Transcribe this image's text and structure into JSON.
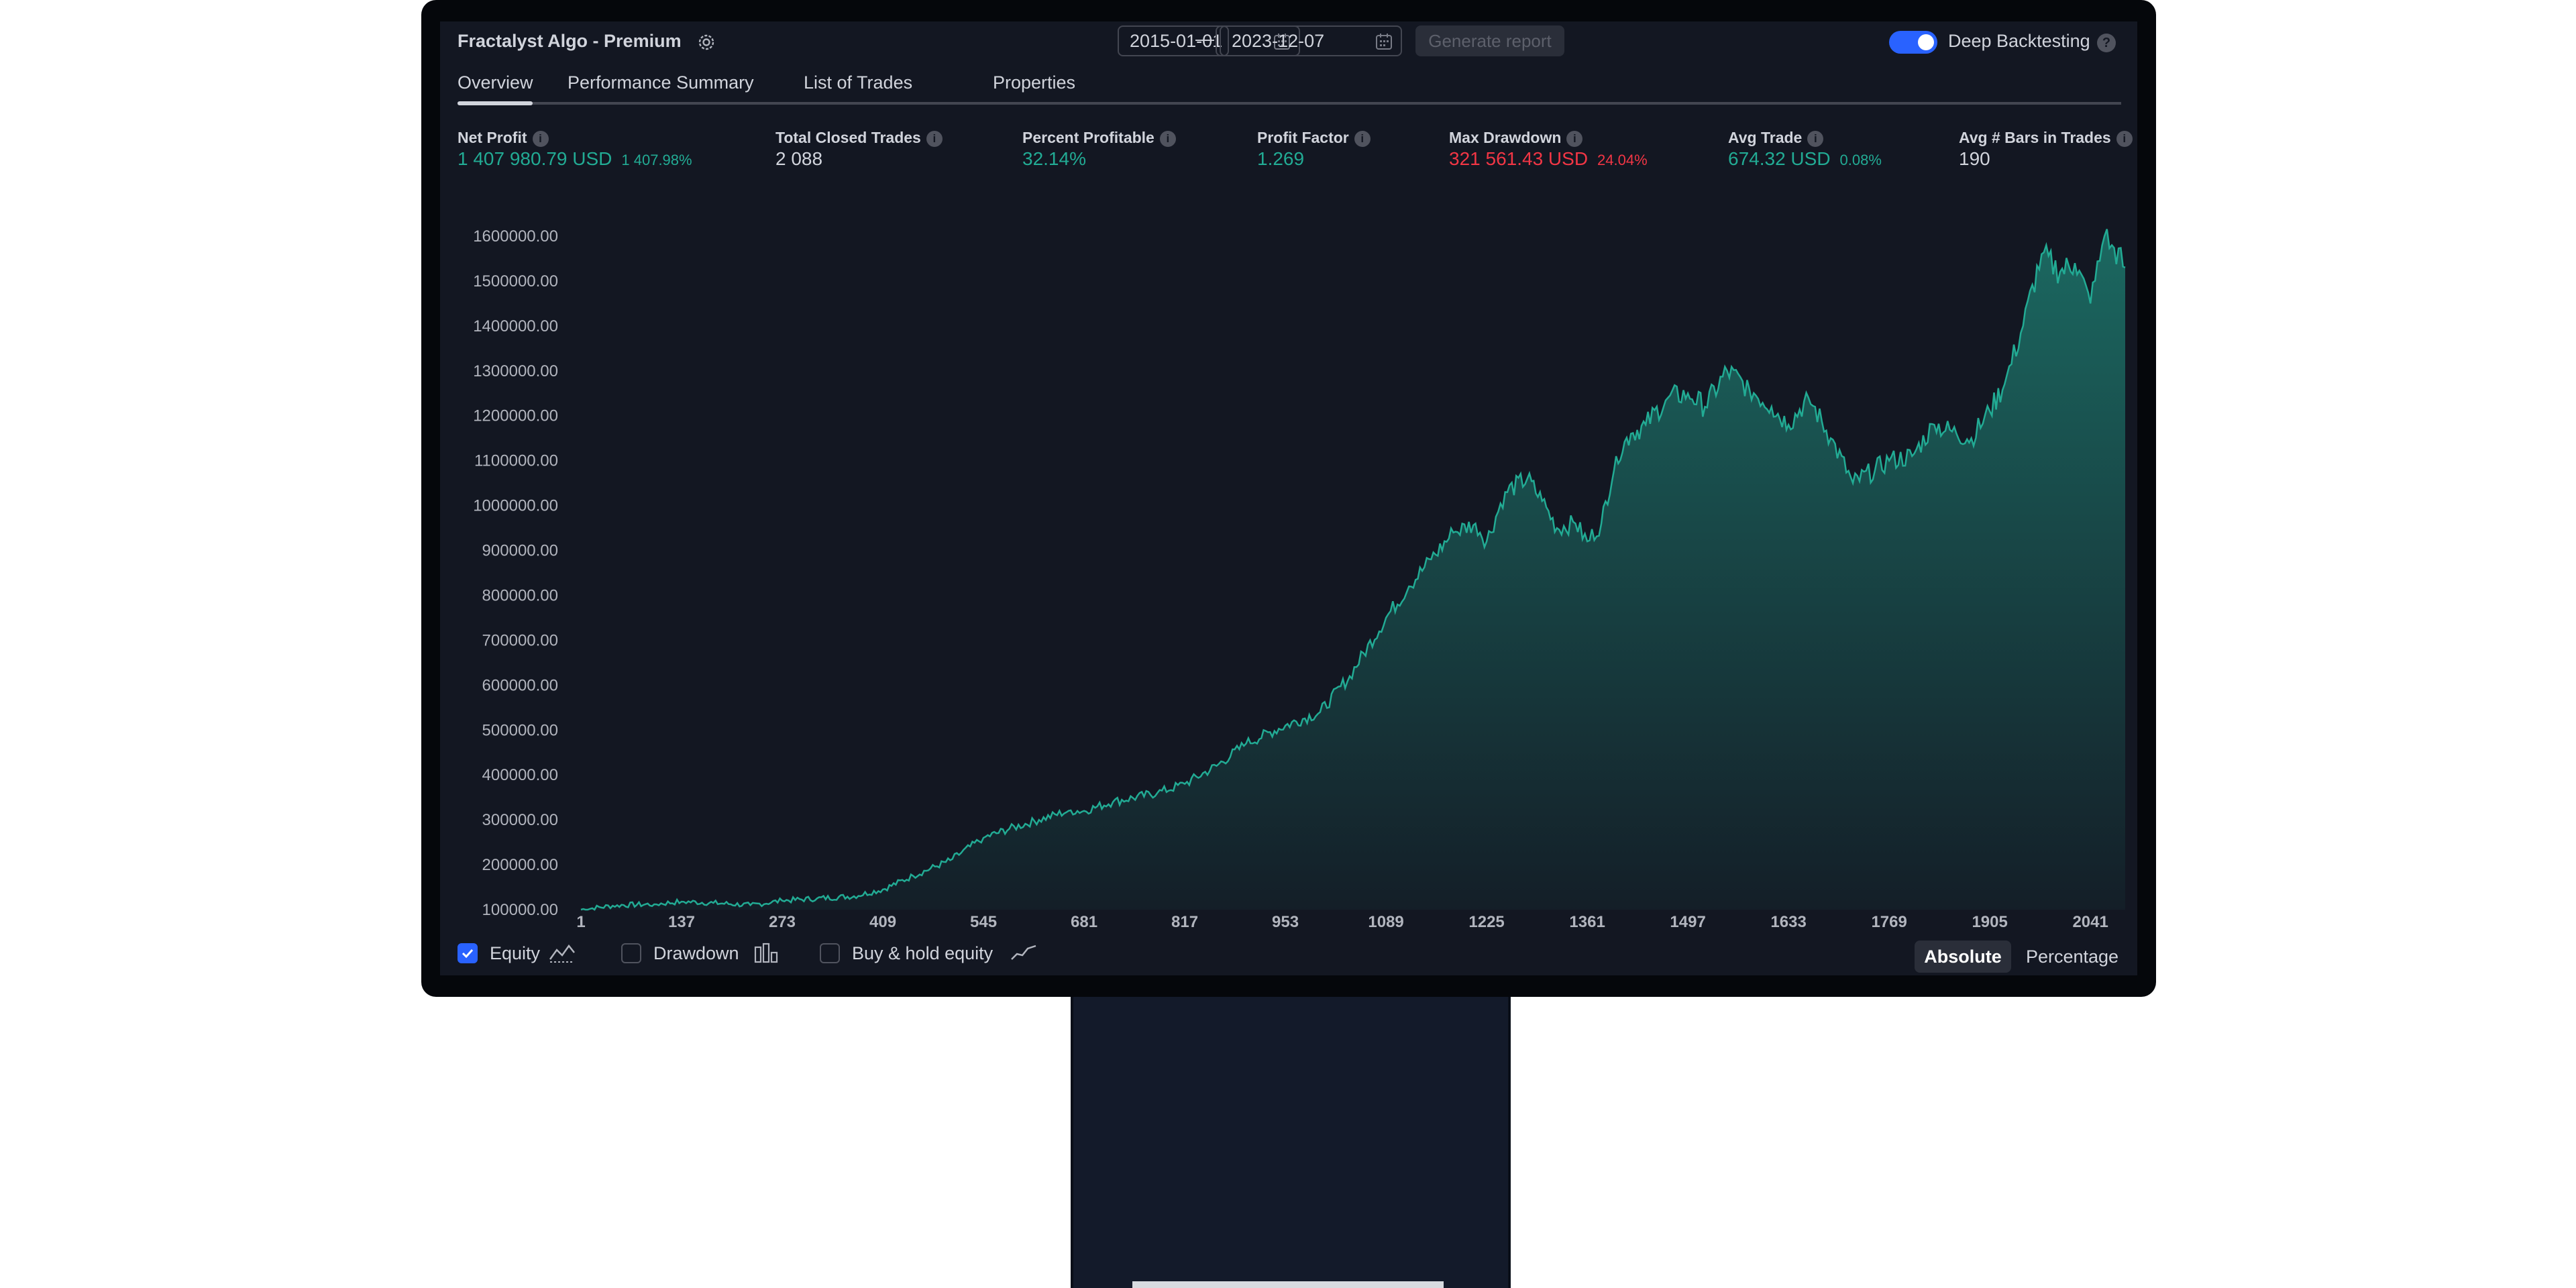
{
  "header": {
    "title": "Fractalyst Algo - Premium",
    "start_date": "2015-01-01",
    "end_date": "2023-12-07",
    "date_separator": "—",
    "generate_label": "Generate report",
    "deep_backtesting_label": "Deep Backtesting",
    "deep_backtesting_enabled": true,
    "help_glyph": "?"
  },
  "tabs": [
    {
      "label": "Overview",
      "active": true
    },
    {
      "label": "Performance Summary",
      "active": false
    },
    {
      "label": "List of Trades",
      "active": false
    },
    {
      "label": "Properties",
      "active": false
    }
  ],
  "metrics": [
    {
      "label": "Net Profit",
      "value": "1 407 980.79 USD",
      "pct": "1 407.98%",
      "tone": "green"
    },
    {
      "label": "Total Closed Trades",
      "value": "2 088",
      "pct": "",
      "tone": "white"
    },
    {
      "label": "Percent Profitable",
      "value": "32.14%",
      "pct": "",
      "tone": "green"
    },
    {
      "label": "Profit Factor",
      "value": "1.269",
      "pct": "",
      "tone": "green"
    },
    {
      "label": "Max Drawdown",
      "value": "321 561.43 USD",
      "pct": "24.04%",
      "tone": "red"
    },
    {
      "label": "Avg Trade",
      "value": "674.32 USD",
      "pct": "0.08%",
      "tone": "green"
    },
    {
      "label": "Avg # Bars in Trades",
      "value": "190",
      "pct": "",
      "tone": "white"
    }
  ],
  "info_glyph": "i",
  "chart_data": {
    "type": "area",
    "series": [
      {
        "x": [
          1,
          50,
          100,
          137,
          180,
          230,
          273,
          320,
          370,
          409,
          450,
          500,
          545,
          580,
          620,
          660,
          681,
          720,
          780,
          817,
          860,
          900,
          953,
          1000,
          1040,
          1089,
          1120,
          1150,
          1180,
          1210,
          1225,
          1250,
          1280,
          1300,
          1320,
          1345,
          1361,
          1380,
          1400,
          1420,
          1440,
          1470,
          1497,
          1520,
          1550,
          1580,
          1610,
          1633,
          1660,
          1690,
          1720,
          1750,
          1769,
          1800,
          1830,
          1860,
          1880,
          1905,
          1925,
          1950,
          1975,
          2000,
          2020,
          2041,
          2060,
          2070,
          2088
        ],
        "y": [
          100000,
          110000,
          112000,
          118000,
          115000,
          110000,
          120000,
          125000,
          130000,
          145000,
          175000,
          210000,
          260000,
          280000,
          300000,
          320000,
          320000,
          340000,
          360000,
          380000,
          420000,
          470000,
          510000,
          540000,
          620000,
          750000,
          820000,
          880000,
          940000,
          960000,
          920000,
          1030000,
          1060000,
          1010000,
          950000,
          960000,
          920000,
          960000,
          1110000,
          1160000,
          1180000,
          1240000,
          1250000,
          1220000,
          1300000,
          1260000,
          1220000,
          1180000,
          1240000,
          1150000,
          1050000,
          1080000,
          1100000,
          1110000,
          1180000,
          1160000,
          1150000,
          1210000,
          1270000,
          1400000,
          1560000,
          1520000,
          1540000,
          1450000,
          1600000,
          1580000,
          1530000
        ]
      }
    ],
    "x_ticks": [
      "1",
      "137",
      "273",
      "409",
      "545",
      "681",
      "817",
      "953",
      "1089",
      "1225",
      "1361",
      "1497",
      "1633",
      "1769",
      "1905",
      "2041"
    ],
    "y_ticks": [
      "1600000.00",
      "1500000.00",
      "1400000.00",
      "1300000.00",
      "1200000.00",
      "1100000.00",
      "1000000.00",
      "900000.00",
      "800000.00",
      "700000.00",
      "600000.00",
      "500000.00",
      "400000.00",
      "300000.00",
      "200000.00",
      "100000.00"
    ],
    "xlim": [
      1,
      2088
    ],
    "ylim": [
      100000,
      1600000
    ],
    "grid": false,
    "line_color": "#22ab94",
    "fill_color": "#22ab94"
  },
  "legend": {
    "equity_label": "Equity",
    "equity_checked": true,
    "drawdown_label": "Drawdown",
    "drawdown_checked": false,
    "buyhold_label": "Buy & hold equity",
    "buyhold_checked": false
  },
  "view_toggle": {
    "absolute_label": "Absolute",
    "percentage_label": "Percentage",
    "selected": "Absolute"
  },
  "colors": {
    "accent": "#2962ff",
    "positive": "#22ab94",
    "negative": "#f23645",
    "background": "#131722"
  },
  "icons": [
    "gear-icon",
    "calendar-icon",
    "info-icon",
    "help-icon",
    "check-icon",
    "equity-line-icon",
    "drawdown-bars-icon",
    "buyhold-line-icon"
  ]
}
